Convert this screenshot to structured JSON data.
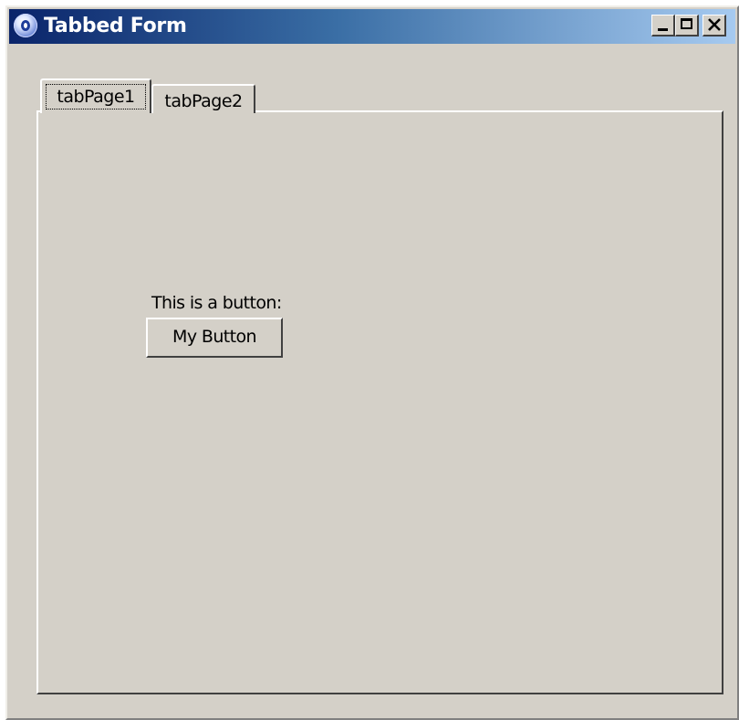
{
  "window": {
    "title": "Tabbed Form",
    "controls": {
      "minimize_icon": "minimize-icon",
      "maximize_icon": "maximize-icon",
      "close_icon": "close-icon"
    },
    "colors": {
      "titlebar_start": "#0a246a",
      "titlebar_end": "#a6caf0",
      "face": "#d4d0c8"
    }
  },
  "tabs": [
    {
      "label": "tabPage1",
      "selected": true
    },
    {
      "label": "tabPage2",
      "selected": false
    }
  ],
  "page": {
    "caption": "This is a button:",
    "button_label": "My Button"
  }
}
